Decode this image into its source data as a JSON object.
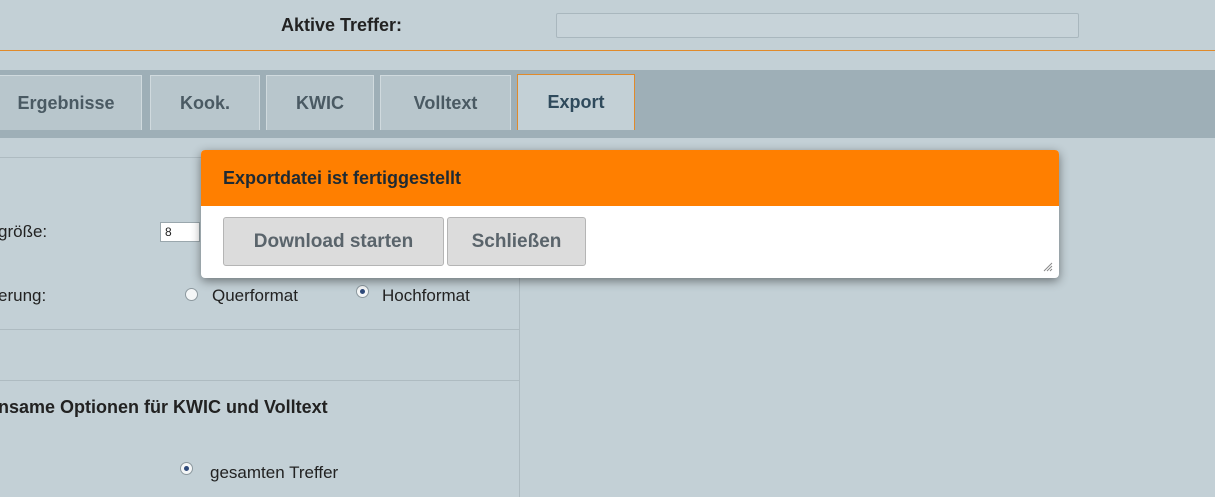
{
  "header": {
    "active_hits_label": "Aktive Treffer:",
    "active_hits_value": ""
  },
  "tabs": [
    {
      "label": "Ergebnisse"
    },
    {
      "label": "Kook."
    },
    {
      "label": "KWIC"
    },
    {
      "label": "Volltext"
    },
    {
      "label": "Export",
      "active": true
    }
  ],
  "left_panel": {
    "font_size_label": "größe:",
    "font_size_value": "8",
    "orientation_label": "erung:",
    "orientation_options": [
      {
        "label": "Querformat",
        "checked": false
      },
      {
        "label": "Hochformat",
        "checked": true
      }
    ],
    "common_options_title": "nsame Optionen für KWIC und Volltext",
    "scope_option": {
      "label": "gesamten Treffer",
      "checked": true
    }
  },
  "dialog": {
    "title": "Exportdatei ist fertiggestellt",
    "download_button": "Download starten",
    "close_button": "Schließen"
  },
  "colors": {
    "accent": "#ff7f00",
    "background": "#c3d0d6",
    "tabbar": "#9eafb7"
  }
}
